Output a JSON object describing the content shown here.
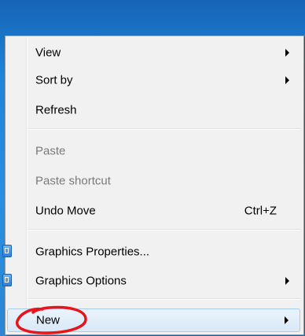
{
  "context_menu": {
    "items": [
      {
        "label": "View",
        "submenu": true,
        "enabled": true
      },
      {
        "label": "Sort by",
        "submenu": true,
        "enabled": true
      },
      {
        "label": "Refresh",
        "submenu": false,
        "enabled": true
      },
      {
        "label": "Paste",
        "submenu": false,
        "enabled": false
      },
      {
        "label": "Paste shortcut",
        "submenu": false,
        "enabled": false
      },
      {
        "label": "Undo Move",
        "shortcut": "Ctrl+Z",
        "submenu": false,
        "enabled": true
      },
      {
        "label": "Graphics Properties...",
        "submenu": false,
        "enabled": true,
        "icon": "graphics-icon"
      },
      {
        "label": "Graphics Options",
        "submenu": true,
        "enabled": true,
        "icon": "graphics-icon"
      },
      {
        "label": "New",
        "submenu": true,
        "enabled": true,
        "highlighted": true
      }
    ]
  },
  "annotation": {
    "color": "#e8141a",
    "shape": "hand-drawn-circle",
    "target": "New"
  },
  "colors": {
    "desktop": "#1f83d6",
    "menu_bg": "#f1f1f1",
    "highlight": "#d9e9f8",
    "disabled_text": "#7a7a7a"
  }
}
